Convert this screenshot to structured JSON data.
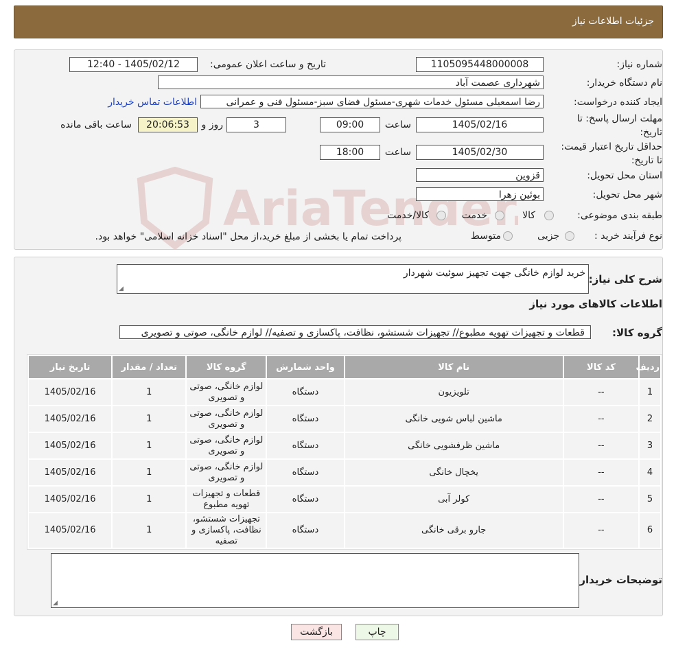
{
  "header": {
    "title": "جزئیات اطلاعات نیاز"
  },
  "form": {
    "need_number_label": "شماره نیاز:",
    "need_number": "1105095448000008",
    "announce_label": "تاریخ و ساعت اعلان عمومی:",
    "announce_value": "1405/02/12 - 12:40",
    "buyer_org_label": "نام دستگاه خریدار:",
    "buyer_org": "شهرداری عصمت آباد",
    "requester_label": "ایجاد کننده درخواست:",
    "requester": "رضا اسمعیلی مسئول خدمات شهری-مسئول فضای سبز-مسئول فنی و عمرانی",
    "contact_link": "اطلاعات تماس خریدار",
    "deadline_label": "مهلت ارسال پاسخ: تا تاریخ:",
    "deadline_date": "1405/02/16",
    "hour_label": "ساعت",
    "deadline_time": "09:00",
    "days_value": "3",
    "days_label": "روز و",
    "remaining_time": "20:06:53",
    "remaining_label": "ساعت باقی مانده",
    "validity_label": "حداقل تاریخ اعتبار قیمت: تا تاریخ:",
    "validity_date": "1405/02/30",
    "validity_time": "18:00",
    "province_label": "استان محل تحویل:",
    "province": "قزوین",
    "city_label": "شهر محل تحویل:",
    "city": "بوئین زهرا",
    "category_label": "طبقه بندی موضوعی:",
    "category_options": [
      "کالا",
      "خدمت",
      "کالا/خدمت"
    ],
    "process_label": "نوع فرآیند خرید :",
    "process_options": [
      "جزیی",
      "متوسط"
    ],
    "payment_note": "پرداخت تمام یا بخشی از مبلغ خرید،از محل \"اسناد خزانه اسلامی\" خواهد بود."
  },
  "details": {
    "description_label": "شرح کلی نیاز:",
    "description": "خرید لوازم خانگی جهت تجهیز سوئیت شهردار",
    "goods_info_title": "اطلاعات کالاهای مورد نیاز",
    "group_label": "گروه کالا:",
    "group_value": "قطعات و تجهیزات تهویه مطبوع// تجهیزات شستشو، نظافت، پاکسازی و تصفیه// لوازم خانگی، صوتی و تصویری"
  },
  "table": {
    "headers": [
      "ردیف",
      "کد کالا",
      "نام کالا",
      "واحد شمارش",
      "گروه کالا",
      "تعداد / مقدار",
      "تاریخ نیاز"
    ],
    "rows": [
      [
        "1",
        "--",
        "تلویزیون",
        "دستگاه",
        "لوازم خانگی، صوتی و تصویری",
        "1",
        "1405/02/16"
      ],
      [
        "2",
        "--",
        "ماشین لباس شویی خانگی",
        "دستگاه",
        "لوازم خانگی، صوتی و تصویری",
        "1",
        "1405/02/16"
      ],
      [
        "3",
        "--",
        "ماشین ظرفشویی خانگی",
        "دستگاه",
        "لوازم خانگی، صوتی و تصویری",
        "1",
        "1405/02/16"
      ],
      [
        "4",
        "--",
        "یخچال خانگی",
        "دستگاه",
        "لوازم خانگی، صوتی و تصویری",
        "1",
        "1405/02/16"
      ],
      [
        "5",
        "--",
        "کولر آبی",
        "دستگاه",
        "قطعات و تجهیزات تهویه مطبوع",
        "1",
        "1405/02/16"
      ],
      [
        "6",
        "--",
        "جارو برقی خانگی",
        "دستگاه",
        "تجهیزات شستشو، نظافت، پاکسازی و تصفیه",
        "1",
        "1405/02/16"
      ]
    ]
  },
  "notes": {
    "label": "توضیحات خریدار:"
  },
  "buttons": {
    "print": "چاپ",
    "back": "بازگشت"
  },
  "watermark": {
    "text": "AriaTender.neT",
    "color": "#a00000"
  }
}
